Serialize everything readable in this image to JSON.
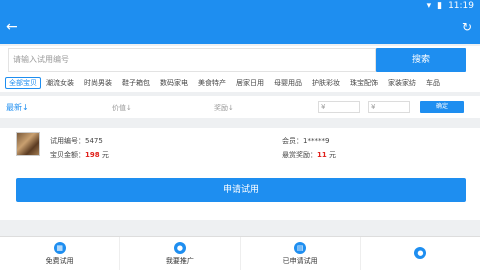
{
  "status": {
    "time": "11:19",
    "wifi_icon": "wifi-icon",
    "battery_icon": "battery-icon"
  },
  "search": {
    "placeholder": "请输入试用编号",
    "button": "搜索"
  },
  "categories": [
    "全部宝贝",
    "潮流女装",
    "时尚男装",
    "鞋子箱包",
    "数码家电",
    "美食特产",
    "居家日用",
    "母婴用品",
    "护肤彩妆",
    "珠宝配饰",
    "家装家纺",
    "车品"
  ],
  "filters": {
    "latest": "最新↓",
    "price": "价值↓",
    "reward": "奖励↓",
    "min_placeholder": "¥",
    "max_placeholder": "¥",
    "confirm": "确定"
  },
  "item": {
    "code_label": "试用编号：",
    "code": "5475",
    "member_label": "会员：",
    "member": "1*****9",
    "amount_label": "宝贝金额：",
    "amount": "198",
    "amount_unit": "元",
    "bounty_label": "悬赏奖励：",
    "bounty": "11",
    "bounty_unit": "元",
    "apply": "申请试用"
  },
  "nav": [
    "免费试用",
    "我要推广",
    "已申请试用",
    ""
  ]
}
